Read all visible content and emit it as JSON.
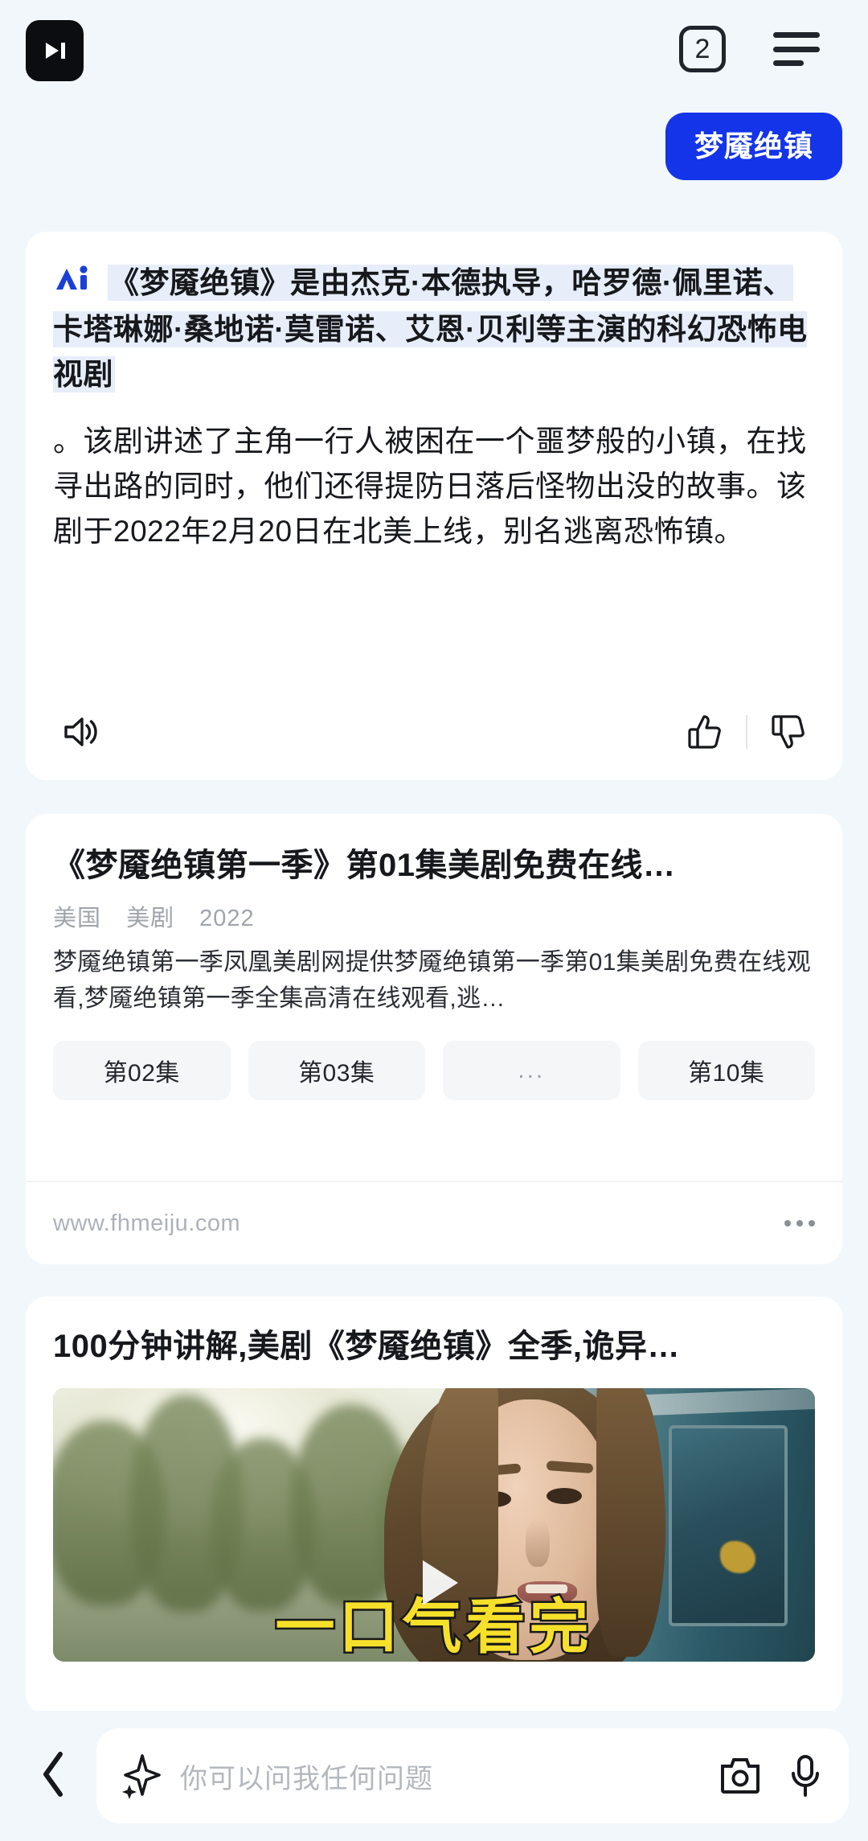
{
  "colors": {
    "page_bg": "#f2f7fb",
    "card_bg": "#ffffff",
    "accent_blue": "#1334e8",
    "ai_logo_blue": "#1a3fd8",
    "highlight_bg": "#e7edf9",
    "caption_yellow": "#f7e02a",
    "text_primary": "#16181c",
    "text_muted": "#a0a4ab"
  },
  "topbar": {
    "logo_name": "app-logo",
    "logo_glyph": "skip-forward",
    "tabs_count": "2",
    "menu_label": "menu"
  },
  "query": {
    "text": "梦魇绝镇"
  },
  "ai_card": {
    "badge": "Ai",
    "highlighted_text": "《梦魇绝镇》是由杰克·本德执导，哈罗德·佩里诺、卡塔琳娜·桑地诺·莫雷诺、艾恩·贝利等主演的科幻恐怖电视剧",
    "rest_text": "。该剧讲述了主角一行人被困在一个噩梦般的小镇，在找寻出路的同时，他们还得提防日落后怪物出没的故事。该剧于2022年2月20日在北美上线，别名逃离恐怖镇。",
    "actions": {
      "speak": "朗读",
      "like": "赞",
      "dislike": "踩"
    }
  },
  "result_card": {
    "title": "《梦魇绝镇第一季》第01集美剧免费在线…",
    "meta": [
      "美国",
      "美剧",
      "2022"
    ],
    "snippet": "梦魇绝镇第一季凤凰美剧网提供梦魇绝镇第一季第01集美剧免费在线观看,梦魇绝镇第一季全集高清在线观看,逃…",
    "chips": [
      "第02集",
      "第03集",
      "...",
      "第10集"
    ],
    "url": "www.fhmeiju.com",
    "more_label": "更多"
  },
  "video_card": {
    "title": "100分钟讲解,美剧《梦魇绝镇》全季,诡异…",
    "thumbnail_caption": "一口气看完",
    "play_label": "播放"
  },
  "bottombar": {
    "back_label": "返回",
    "sparkle_label": "AI 助手",
    "placeholder": "你可以问我任何问题",
    "camera_label": "拍照搜索",
    "mic_label": "语音输入"
  }
}
